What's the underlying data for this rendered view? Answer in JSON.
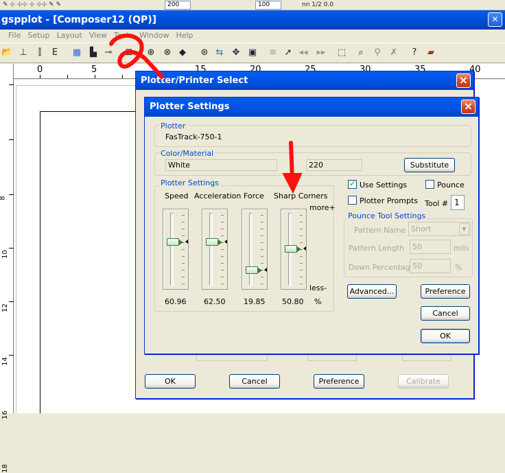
{
  "topbar": {
    "zoom1": "200",
    "zoom2": "100",
    "nums": "nn 1/2 0.0"
  },
  "app": {
    "title": "gspplot - [Composer12 (QP)]",
    "menu": [
      "File",
      "Setup",
      "Layout",
      "View",
      "Tools",
      "Window",
      "Help"
    ],
    "ruler_labels": [
      "0",
      "5",
      "15",
      "20",
      "25",
      "30",
      "35",
      "40"
    ],
    "vruler_labels": [
      "8",
      "10",
      "12",
      "14",
      "16",
      "18"
    ]
  },
  "printer_select": {
    "title": "Plotter/Printer Select",
    "ok_label": "OK",
    "cancel_label": "Cancel",
    "preference_label": "Preference",
    "calibrate_label": "Calibrate"
  },
  "plotter_settings": {
    "title": "Plotter Settings",
    "plotter_group": "Plotter",
    "plotter_name": "FasTrack-750-1",
    "color_group": "Color/Material",
    "material": "White",
    "material_code": "220",
    "substitute_label": "Substitute",
    "settings_group": "Plotter Settings",
    "sliders": [
      {
        "label": "Speed",
        "value": "60.96",
        "level": 0.62
      },
      {
        "label": "Acceleration",
        "value": "62.50",
        "level": 0.63
      },
      {
        "label": "Force",
        "value": "19.85",
        "level": 0.2
      },
      {
        "label": "Sharp Corners",
        "value": "50.80",
        "level": 0.52
      }
    ],
    "more_label": "more+",
    "less_label": "less-",
    "unit_label": "%",
    "use_settings_label": "Use Settings",
    "use_settings_checked": true,
    "pounce_label": "Pounce",
    "pounce_checked": false,
    "plotter_prompts_label": "Plotter Prompts",
    "plotter_prompts_checked": false,
    "tool_label": "Tool #",
    "tool_value": "1",
    "pounce_group": "Pounce Tool Settings",
    "pattern_name_label": "Pattern Name",
    "pattern_name_value": "Short",
    "pattern_length_label": "Pattern Length",
    "pattern_length_value": "50",
    "pattern_length_unit": "mils",
    "down_pct_label": "Down Percentage",
    "down_pct_value": "50",
    "down_pct_unit": "%",
    "advanced_label": "Advanced...",
    "preference_label": "Preference",
    "cancel_label": "Cancel",
    "ok_label": "OK"
  },
  "colors": {
    "xp_title": "#0054e3",
    "group_label": "#0046d5",
    "annotation": "#ff0000"
  }
}
